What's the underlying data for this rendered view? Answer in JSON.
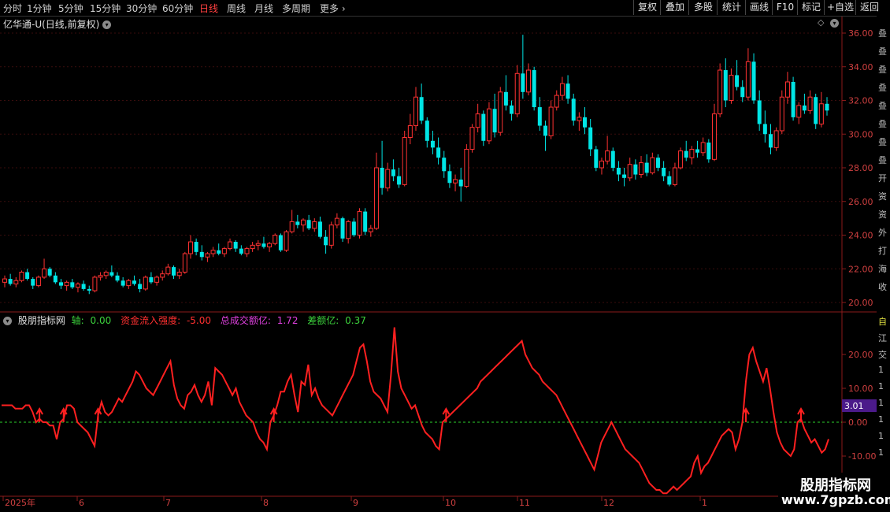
{
  "toolbar": {
    "timeframes": [
      "分时",
      "1分钟",
      "5分钟",
      "15分钟",
      "30分钟",
      "60分钟",
      "日线",
      "周线",
      "月线",
      "多周期",
      "更多"
    ],
    "active": "日线",
    "buttons": [
      "复权",
      "叠加",
      "多股",
      "统计",
      "画线",
      "F10",
      "标记",
      "+自选",
      "返回"
    ]
  },
  "main": {
    "title": "亿华通-U(日线,前复权)",
    "price_ticks": [
      "36.00",
      "34.00",
      "32.00",
      "30.00",
      "28.00",
      "26.00",
      "24.00",
      "22.00",
      "20.00"
    ]
  },
  "indicator": {
    "name": "股朋指标网",
    "fields": [
      {
        "label": "轴:",
        "value": "0.00",
        "color": "#3cd23c"
      },
      {
        "label": "资金流入强度:",
        "value": "-5.00",
        "color": "#ff3030"
      },
      {
        "label": "总成交额亿:",
        "value": "1.72",
        "color": "#e040e0"
      },
      {
        "label": "差额亿:",
        "value": "0.37",
        "color": "#3cd23c"
      }
    ],
    "ticks": [
      "20.00",
      "10.00",
      "0.00",
      "-10.00"
    ],
    "current_value": "3.01"
  },
  "xaxis": {
    "labels": [
      "2025年",
      "6",
      "7",
      "8",
      "9",
      "10",
      "11",
      "12",
      "1"
    ]
  },
  "right_strip_chars": [
    "叠",
    "叠",
    "叠",
    "叠",
    "叠",
    "叠",
    "叠",
    "叠",
    "开",
    "资",
    "资",
    "外",
    "打",
    "海",
    "收"
  ],
  "right_strip_lower": [
    "自",
    "江",
    "交",
    "1",
    "1",
    "1",
    "1",
    "1",
    "1"
  ],
  "watermark": {
    "line1": "股朋指标网",
    "line2": "www.7gpzb.com"
  },
  "chart_data": {
    "type": "candlestick+line",
    "candles_ohlc": [
      [
        21.2,
        21.6,
        20.9,
        21.4
      ],
      [
        21.4,
        21.7,
        21.0,
        21.1
      ],
      [
        21.1,
        21.5,
        20.9,
        21.3
      ],
      [
        21.3,
        21.9,
        21.2,
        21.8
      ],
      [
        21.8,
        22.0,
        21.3,
        21.4
      ],
      [
        21.4,
        21.5,
        20.8,
        21.0
      ],
      [
        21.0,
        21.6,
        20.9,
        21.5
      ],
      [
        21.5,
        22.6,
        21.4,
        22.0
      ],
      [
        22.0,
        22.1,
        21.5,
        21.6
      ],
      [
        21.6,
        21.8,
        21.1,
        21.2
      ],
      [
        21.2,
        21.4,
        20.8,
        21.0
      ],
      [
        21.0,
        21.3,
        20.7,
        21.2
      ],
      [
        21.2,
        21.4,
        20.8,
        20.9
      ],
      [
        20.9,
        21.2,
        20.6,
        21.1
      ],
      [
        21.1,
        21.3,
        20.7,
        20.8
      ],
      [
        20.8,
        21.0,
        20.5,
        20.7
      ],
      [
        20.7,
        21.6,
        20.6,
        21.5
      ],
      [
        21.5,
        21.8,
        21.3,
        21.6
      ],
      [
        21.6,
        21.9,
        21.4,
        21.8
      ],
      [
        21.8,
        22.2,
        21.5,
        21.6
      ],
      [
        21.6,
        21.8,
        21.2,
        21.3
      ],
      [
        21.3,
        21.5,
        20.9,
        21.0
      ],
      [
        21.0,
        21.4,
        20.8,
        21.3
      ],
      [
        21.3,
        21.6,
        21.0,
        21.1
      ],
      [
        21.1,
        21.4,
        20.6,
        20.8
      ],
      [
        20.8,
        21.6,
        20.7,
        21.5
      ],
      [
        21.5,
        21.8,
        21.1,
        21.2
      ],
      [
        21.2,
        21.6,
        21.0,
        21.5
      ],
      [
        21.5,
        21.9,
        21.3,
        21.7
      ],
      [
        21.7,
        22.3,
        21.6,
        22.1
      ],
      [
        22.1,
        22.2,
        21.4,
        21.6
      ],
      [
        21.6,
        22.0,
        21.4,
        21.8
      ],
      [
        21.8,
        23.0,
        21.7,
        22.9
      ],
      [
        22.9,
        24.0,
        22.6,
        23.6
      ],
      [
        23.6,
        23.8,
        22.8,
        23.0
      ],
      [
        23.0,
        23.4,
        22.5,
        22.7
      ],
      [
        22.7,
        23.0,
        22.4,
        22.9
      ],
      [
        22.9,
        23.3,
        22.7,
        23.1
      ],
      [
        23.1,
        23.5,
        22.8,
        22.9
      ],
      [
        22.9,
        23.3,
        22.7,
        23.2
      ],
      [
        23.2,
        23.8,
        23.1,
        23.6
      ],
      [
        23.6,
        23.7,
        23.0,
        23.2
      ],
      [
        23.2,
        23.4,
        22.8,
        22.9
      ],
      [
        22.9,
        23.3,
        22.7,
        23.2
      ],
      [
        23.2,
        23.6,
        23.0,
        23.4
      ],
      [
        23.4,
        23.7,
        23.1,
        23.5
      ],
      [
        23.5,
        23.9,
        23.2,
        23.3
      ],
      [
        23.3,
        23.6,
        23.0,
        23.5
      ],
      [
        23.5,
        24.1,
        23.4,
        24.0
      ],
      [
        24.0,
        24.1,
        23.0,
        23.1
      ],
      [
        23.1,
        24.3,
        23.0,
        24.2
      ],
      [
        24.2,
        25.5,
        24.1,
        24.8
      ],
      [
        24.8,
        25.2,
        24.4,
        24.6
      ],
      [
        24.6,
        25.0,
        24.2,
        24.9
      ],
      [
        24.9,
        25.2,
        24.3,
        24.4
      ],
      [
        24.4,
        25.0,
        24.2,
        24.8
      ],
      [
        24.8,
        25.1,
        23.8,
        23.9
      ],
      [
        23.9,
        24.3,
        22.9,
        23.4
      ],
      [
        23.4,
        24.8,
        23.2,
        24.6
      ],
      [
        24.6,
        25.3,
        24.4,
        25.0
      ],
      [
        25.0,
        25.1,
        23.6,
        23.8
      ],
      [
        23.8,
        24.9,
        23.5,
        24.8
      ],
      [
        24.8,
        25.0,
        23.9,
        24.0
      ],
      [
        24.0,
        25.6,
        23.8,
        25.4
      ],
      [
        25.4,
        25.6,
        24.0,
        24.2
      ],
      [
        24.2,
        24.6,
        23.9,
        24.4
      ],
      [
        24.4,
        28.9,
        24.3,
        28.0
      ],
      [
        28.0,
        29.6,
        26.4,
        26.8
      ],
      [
        26.8,
        28.3,
        26.6,
        27.9
      ],
      [
        27.9,
        28.5,
        27.2,
        27.5
      ],
      [
        27.5,
        28.0,
        26.8,
        27.0
      ],
      [
        27.0,
        30.2,
        26.9,
        29.8
      ],
      [
        29.8,
        31.2,
        29.4,
        30.5
      ],
      [
        30.5,
        32.8,
        30.2,
        32.2
      ],
      [
        32.2,
        33.0,
        30.6,
        30.8
      ],
      [
        30.8,
        31.0,
        29.2,
        29.6
      ],
      [
        29.6,
        30.2,
        28.8,
        29.2
      ],
      [
        29.2,
        29.8,
        28.2,
        28.6
      ],
      [
        28.6,
        29.0,
        27.4,
        27.8
      ],
      [
        27.8,
        28.2,
        26.8,
        27.1
      ],
      [
        27.1,
        27.6,
        26.6,
        27.3
      ],
      [
        27.3,
        28.0,
        26.0,
        26.9
      ],
      [
        26.9,
        29.4,
        26.8,
        29.1
      ],
      [
        29.1,
        30.6,
        28.9,
        30.4
      ],
      [
        30.4,
        31.8,
        30.1,
        31.2
      ],
      [
        31.2,
        31.4,
        29.3,
        29.6
      ],
      [
        29.6,
        31.9,
        29.4,
        31.5
      ],
      [
        31.5,
        32.4,
        29.8,
        30.1
      ],
      [
        30.1,
        32.8,
        29.9,
        32.5
      ],
      [
        32.5,
        33.5,
        31.4,
        31.7
      ],
      [
        31.7,
        32.0,
        30.8,
        31.2
      ],
      [
        31.2,
        34.1,
        31.0,
        33.6
      ],
      [
        33.6,
        35.9,
        32.1,
        32.5
      ],
      [
        32.5,
        34.2,
        32.3,
        33.8
      ],
      [
        33.8,
        34.0,
        31.4,
        31.6
      ],
      [
        31.6,
        32.2,
        30.2,
        30.5
      ],
      [
        30.5,
        30.8,
        29.0,
        29.9
      ],
      [
        29.9,
        32.0,
        29.7,
        31.6
      ],
      [
        31.6,
        32.6,
        31.4,
        32.3
      ],
      [
        32.3,
        33.4,
        32.0,
        33.0
      ],
      [
        33.0,
        33.5,
        31.8,
        32.1
      ],
      [
        32.1,
        32.4,
        30.5,
        30.8
      ],
      [
        30.8,
        31.3,
        30.2,
        31.0
      ],
      [
        31.0,
        31.6,
        30.0,
        30.4
      ],
      [
        30.4,
        30.9,
        28.7,
        29.1
      ],
      [
        29.1,
        29.3,
        27.8,
        28.0
      ],
      [
        28.0,
        28.6,
        27.6,
        28.4
      ],
      [
        28.4,
        29.9,
        28.2,
        29.0
      ],
      [
        29.0,
        29.2,
        27.8,
        28.0
      ],
      [
        28.0,
        28.4,
        27.2,
        27.6
      ],
      [
        27.6,
        28.0,
        26.9,
        27.4
      ],
      [
        27.4,
        28.6,
        27.2,
        28.2
      ],
      [
        28.2,
        28.5,
        27.3,
        27.6
      ],
      [
        27.6,
        28.7,
        27.4,
        28.3
      ],
      [
        28.3,
        28.8,
        27.5,
        27.7
      ],
      [
        27.7,
        28.9,
        27.6,
        28.6
      ],
      [
        28.6,
        28.8,
        27.8,
        28.0
      ],
      [
        28.0,
        28.4,
        27.2,
        27.5
      ],
      [
        27.5,
        27.8,
        26.9,
        27.0
      ],
      [
        27.0,
        28.3,
        26.9,
        28.0
      ],
      [
        28.0,
        29.2,
        27.9,
        29.0
      ],
      [
        29.0,
        29.6,
        28.4,
        28.6
      ],
      [
        28.6,
        29.3,
        28.2,
        29.1
      ],
      [
        29.1,
        29.6,
        28.6,
        28.9
      ],
      [
        28.9,
        29.8,
        28.7,
        29.5
      ],
      [
        29.5,
        29.7,
        28.3,
        28.5
      ],
      [
        28.5,
        31.8,
        28.4,
        31.2
      ],
      [
        31.2,
        34.2,
        31.0,
        33.8
      ],
      [
        33.8,
        34.5,
        31.6,
        32.0
      ],
      [
        32.0,
        33.9,
        31.8,
        33.5
      ],
      [
        33.5,
        34.4,
        32.6,
        32.8
      ],
      [
        32.8,
        33.2,
        31.9,
        32.2
      ],
      [
        32.2,
        35.1,
        32.0,
        34.3
      ],
      [
        34.3,
        34.8,
        31.8,
        32.0
      ],
      [
        32.0,
        32.6,
        30.2,
        30.6
      ],
      [
        30.6,
        31.4,
        29.5,
        30.0
      ],
      [
        30.0,
        30.6,
        28.8,
        29.2
      ],
      [
        29.2,
        30.4,
        29.0,
        30.2
      ],
      [
        30.2,
        32.6,
        30.0,
        32.2
      ],
      [
        32.2,
        33.7,
        31.8,
        33.1
      ],
      [
        33.1,
        33.4,
        30.8,
        31.0
      ],
      [
        31.0,
        31.9,
        30.6,
        31.7
      ],
      [
        31.7,
        32.4,
        31.2,
        31.4
      ],
      [
        31.4,
        32.6,
        31.2,
        32.2
      ],
      [
        32.2,
        32.4,
        30.3,
        30.6
      ],
      [
        30.6,
        32.5,
        30.4,
        31.8
      ],
      [
        31.8,
        32.2,
        31.1,
        31.4
      ]
    ],
    "indicator_series": [
      5,
      5,
      5,
      5,
      4,
      4,
      4,
      5,
      5,
      3,
      0,
      1,
      0,
      0,
      -1,
      -1,
      -5,
      0,
      1,
      5,
      5,
      4,
      0,
      -1,
      -2,
      -3,
      -5,
      -7,
      2,
      6,
      3,
      2,
      3,
      5,
      7,
      6,
      8,
      10,
      12,
      15,
      14,
      12,
      10,
      9,
      8,
      10,
      12,
      14,
      16,
      18,
      11,
      7,
      5,
      4,
      8,
      9,
      11,
      8,
      6,
      8,
      12,
      5,
      16,
      15,
      14,
      12,
      10,
      8,
      10,
      6,
      4,
      2,
      1,
      0,
      -3,
      -5,
      -6,
      -8,
      0,
      2,
      5,
      9,
      9,
      12,
      14,
      8,
      3,
      12,
      11,
      17,
      8,
      10,
      7,
      5,
      4,
      3,
      2,
      4,
      6,
      8,
      10,
      12,
      14,
      18,
      22,
      23,
      18,
      12,
      9,
      8,
      7,
      5,
      3,
      14,
      28,
      15,
      10,
      8,
      6,
      4,
      5,
      2,
      -1,
      -3,
      -4,
      -5,
      -7,
      -8,
      0,
      1,
      2,
      3,
      4,
      5,
      6,
      7,
      8,
      9,
      10,
      12,
      13,
      14,
      15,
      16,
      17,
      18,
      19,
      20,
      21,
      22,
      23,
      24,
      20,
      18,
      16,
      15,
      14,
      12,
      11,
      10,
      9,
      8,
      6,
      4,
      2,
      0,
      -2,
      -4,
      -6,
      -8,
      -10,
      -12,
      -14,
      -10,
      -6,
      -4,
      -2,
      0,
      -2,
      -4,
      -6,
      -8,
      -9,
      -10,
      -11,
      -12,
      -14,
      -16,
      -18,
      -19,
      -20,
      -20,
      -21,
      -21,
      -20,
      -19,
      -20,
      -19,
      -18,
      -17,
      -16,
      -12,
      -10,
      -15,
      -13,
      -12,
      -10,
      -8,
      -6,
      -4,
      -3,
      -2,
      -3,
      -8,
      -5,
      0,
      12,
      20,
      22,
      18,
      15,
      12,
      16,
      10,
      3,
      -3,
      -6,
      -8,
      -9,
      -10,
      -8,
      0,
      1,
      -2,
      -4,
      -6,
      -5,
      -7,
      -9,
      -8,
      -5
    ]
  }
}
